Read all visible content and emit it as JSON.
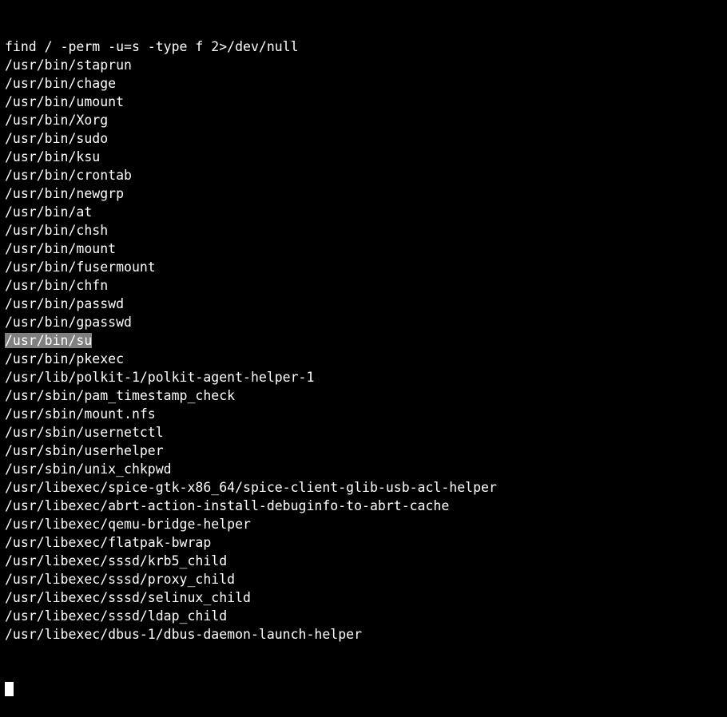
{
  "terminal": {
    "theme": {
      "background": "#000000",
      "foreground": "#ffffff",
      "selection_background": "#808080",
      "cursor": "#ffffff"
    },
    "command": "find / -perm -u=s -type f 2>/dev/null",
    "selected_line_index": 16,
    "cursor": {
      "shape": "block",
      "row": 33,
      "column": 0
    },
    "lines": [
      "find / -perm -u=s -type f 2>/dev/null",
      "/usr/bin/staprun",
      "/usr/bin/chage",
      "/usr/bin/umount",
      "/usr/bin/Xorg",
      "/usr/bin/sudo",
      "/usr/bin/ksu",
      "/usr/bin/crontab",
      "/usr/bin/newgrp",
      "/usr/bin/at",
      "/usr/bin/chsh",
      "/usr/bin/mount",
      "/usr/bin/fusermount",
      "/usr/bin/chfn",
      "/usr/bin/passwd",
      "/usr/bin/gpasswd",
      "/usr/bin/su",
      "/usr/bin/pkexec",
      "/usr/lib/polkit-1/polkit-agent-helper-1",
      "/usr/sbin/pam_timestamp_check",
      "/usr/sbin/mount.nfs",
      "/usr/sbin/usernetctl",
      "/usr/sbin/userhelper",
      "/usr/sbin/unix_chkpwd",
      "/usr/libexec/spice-gtk-x86_64/spice-client-glib-usb-acl-helper",
      "/usr/libexec/abrt-action-install-debuginfo-to-abrt-cache",
      "/usr/libexec/qemu-bridge-helper",
      "/usr/libexec/flatpak-bwrap",
      "/usr/libexec/sssd/krb5_child",
      "/usr/libexec/sssd/proxy_child",
      "/usr/libexec/sssd/selinux_child",
      "/usr/libexec/sssd/ldap_child",
      "/usr/libexec/dbus-1/dbus-daemon-launch-helper"
    ]
  }
}
